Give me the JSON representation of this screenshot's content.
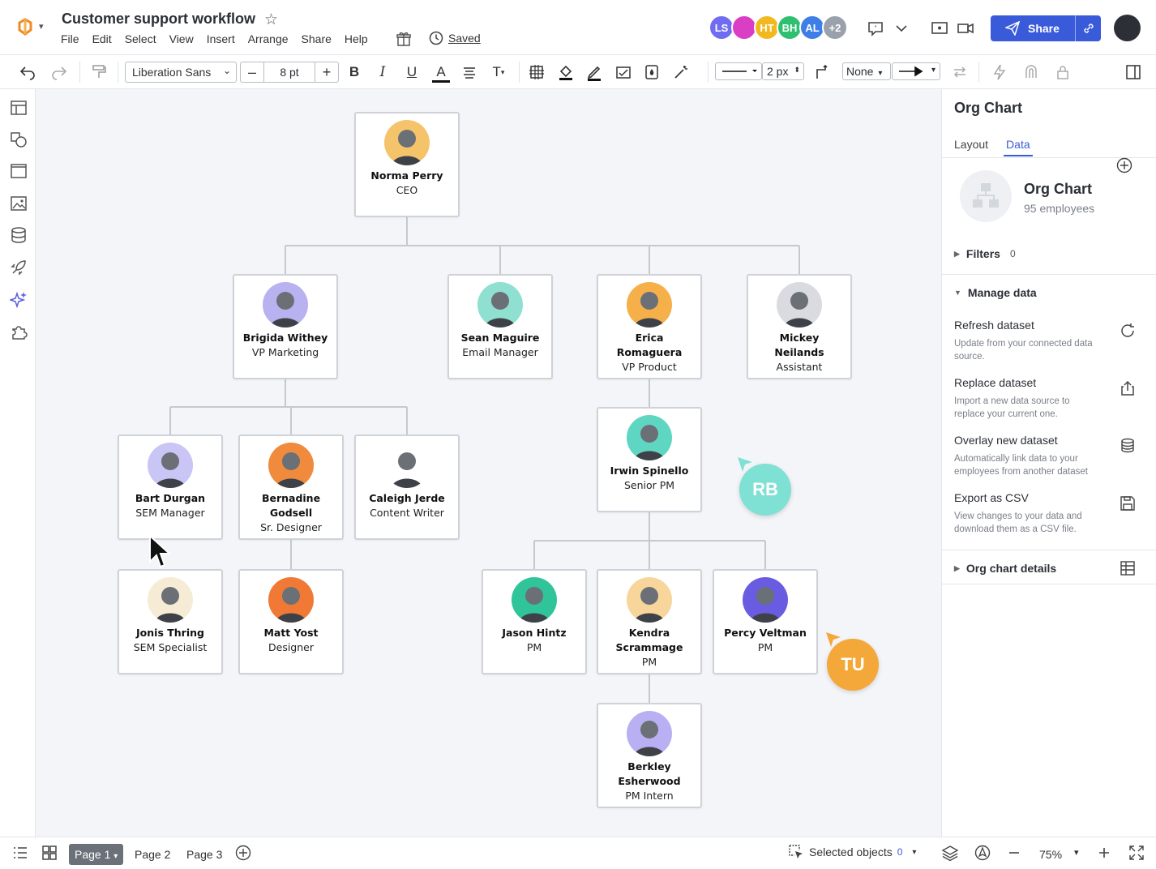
{
  "titlebar": {
    "doc_title": "Customer support workflow",
    "menu": [
      "File",
      "Edit",
      "Select",
      "View",
      "Insert",
      "Arrange",
      "Share",
      "Help"
    ],
    "saved_label": "Saved",
    "collaborators": [
      {
        "initials": "LS",
        "color": "#6f6cf2"
      },
      {
        "initials": "",
        "color": "#d93ec4"
      },
      {
        "initials": "HT",
        "color": "#f2b820"
      },
      {
        "initials": "BH",
        "color": "#2fbf71"
      },
      {
        "initials": "AL",
        "color": "#3d7fe6"
      },
      {
        "initials": "+2",
        "color": "#9aa1ad"
      }
    ],
    "share_label": "Share",
    "accent": "#3a5bd9"
  },
  "toolbar": {
    "font_family": "Liberation Sans",
    "font_size": "8 pt",
    "bold": "B",
    "italic": "I",
    "underline": "U",
    "text_color": "A",
    "text_option": "T",
    "effects_count": "8",
    "line_width": "2 px",
    "endpoint_start": "None",
    "caret": "▾"
  },
  "org_chart": {
    "people": [
      {
        "id": "norma",
        "name": "Norma Perry",
        "role": "CEO",
        "photo_bg": "#f5c46a"
      },
      {
        "id": "brigida",
        "name": "Brigida Withey",
        "role": "VP Marketing",
        "photo_bg": "#b9b2f0"
      },
      {
        "id": "sean",
        "name": "Sean Maguire",
        "role": "Email Manager",
        "photo_bg": "#8fe0d0"
      },
      {
        "id": "erica",
        "name": "Erica Romaguera",
        "role": "VP Product",
        "photo_bg": "#f5b04a"
      },
      {
        "id": "mickey",
        "name": "Mickey Neilands",
        "role": "Assistant",
        "photo_bg": "#d9dbe0"
      },
      {
        "id": "bart",
        "name": "Bart Durgan",
        "role": "SEM Manager",
        "photo_bg": "#c9c5f5"
      },
      {
        "id": "bernadine",
        "name": "Bernadine Godsell",
        "role": "Sr. Designer",
        "photo_bg": "#f08a3c"
      },
      {
        "id": "caleigh",
        "name": "Caleigh Jerde",
        "role": "Content Writer",
        "photo_bg": "#ffffff"
      },
      {
        "id": "irwin",
        "name": "Irwin Spinello",
        "role": "Senior PM",
        "photo_bg": "#5fd6c2"
      },
      {
        "id": "jonis",
        "name": "Jonis Thring",
        "role": "SEM Specialist",
        "photo_bg": "#f6ecd6"
      },
      {
        "id": "matt",
        "name": "Matt Yost",
        "role": "Designer",
        "photo_bg": "#f07a35"
      },
      {
        "id": "jason",
        "name": "Jason Hintz",
        "role": "PM",
        "photo_bg": "#2fc49a"
      },
      {
        "id": "kendra",
        "name": "Kendra Scrammage",
        "role": "PM",
        "photo_bg": "#f8d59a"
      },
      {
        "id": "percy",
        "name": "Percy Veltman",
        "role": "PM",
        "photo_bg": "#6a5ce0"
      },
      {
        "id": "berkley",
        "name": "Berkley Esherwood",
        "role": "PM Intern",
        "photo_bg": "#b8b0f2"
      }
    ],
    "cursors": [
      {
        "initials": "RB",
        "color": "#7fe0d4"
      },
      {
        "initials": "TU",
        "color": "#f4a83a"
      }
    ]
  },
  "panel": {
    "title": "Org Chart",
    "tabs": [
      "Layout",
      "Data"
    ],
    "active_tab": "Data",
    "dataset_name": "Org Chart",
    "dataset_count": "95 employees",
    "filters_label": "Filters",
    "filters_count": "0",
    "manage_label": "Manage data",
    "items": [
      {
        "title": "Refresh dataset",
        "desc": "Update from your connected data source.",
        "icon": "refresh-icon"
      },
      {
        "title": "Replace dataset",
        "desc": "Import a new data source to replace your current one.",
        "icon": "upload-icon"
      },
      {
        "title": "Overlay new dataset",
        "desc": "Automatically link data to your employees from another dataset",
        "icon": "database-icon"
      },
      {
        "title": "Export as CSV",
        "desc": "View changes to your data and download them as a CSV file.",
        "icon": "save-icon"
      }
    ],
    "details_label": "Org chart details"
  },
  "bottombar": {
    "pages": [
      "Page 1",
      "Page 2",
      "Page 3"
    ],
    "active_page": "Page 1",
    "selected_label": "Selected objects",
    "selected_count": "0",
    "zoom": "75%"
  }
}
